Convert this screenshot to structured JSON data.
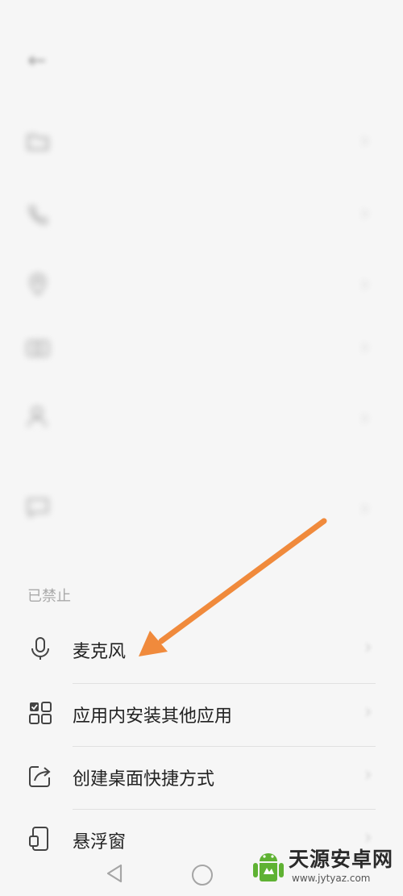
{
  "status_bar": {
    "left_text": "",
    "right_text": ""
  },
  "header": {
    "title": "",
    "sub_label": ""
  },
  "allowed_permissions": [
    {
      "icon": "folder-icon",
      "name": "",
      "desc": ""
    },
    {
      "icon": "phone-icon",
      "name": "",
      "desc": ""
    },
    {
      "icon": "location-icon",
      "name": "",
      "desc": ""
    },
    {
      "icon": "camera-icon",
      "name": "",
      "desc": ""
    },
    {
      "icon": "contacts-icon",
      "name": "",
      "desc": ""
    },
    {
      "icon": "message-icon",
      "name": "",
      "desc": ""
    }
  ],
  "forbidden_section": {
    "label": "已禁止",
    "items": [
      {
        "icon": "microphone-icon",
        "label": "麦克风"
      },
      {
        "icon": "app-grid-icon",
        "label": "应用内安装其他应用"
      },
      {
        "icon": "shortcut-icon",
        "label": "创建桌面快捷方式"
      },
      {
        "icon": "floating-window-icon",
        "label": "悬浮窗"
      }
    ]
  },
  "annotation": {
    "arrow_color": "#f08a3c"
  },
  "watermark": {
    "text": "天源安卓网",
    "url": "www.jytyaz.com",
    "logo_color": "#5fb233"
  },
  "colors": {
    "background": "#f6f6f6",
    "text": "#222222",
    "muted": "#a9a9a9"
  }
}
